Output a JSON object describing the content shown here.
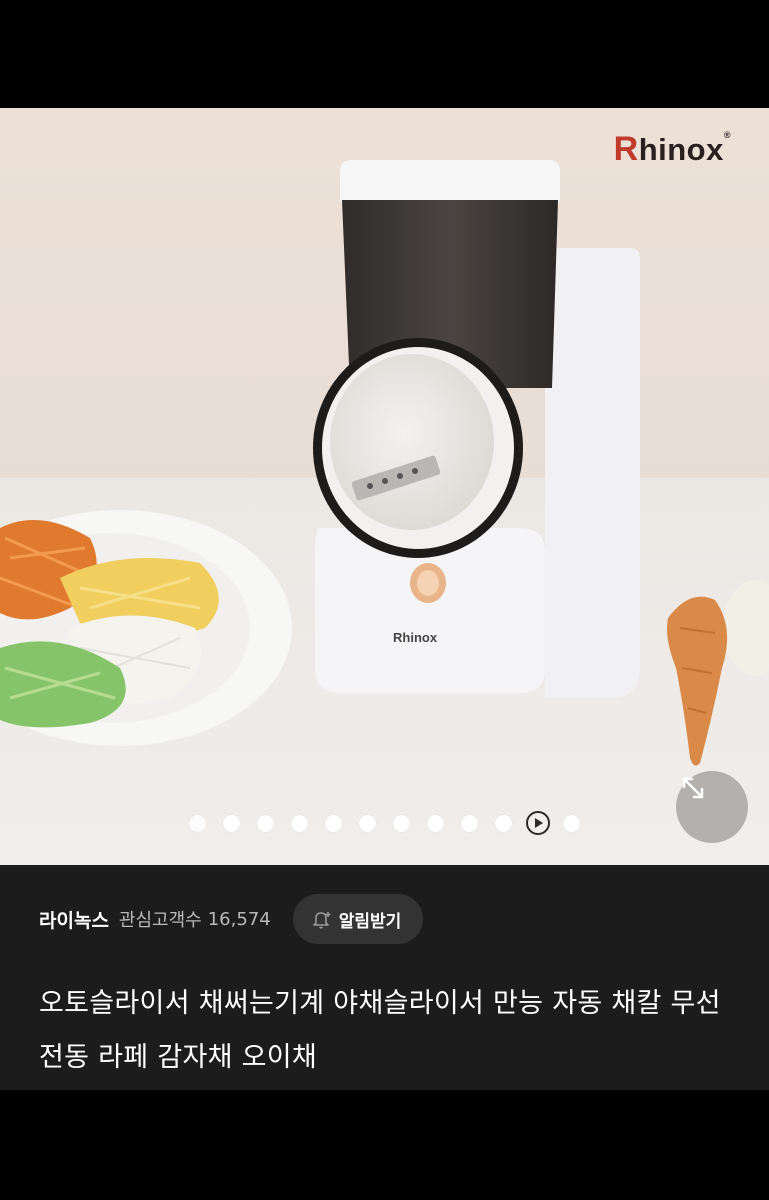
{
  "product_image": {
    "brand_logo": "Rhinox",
    "device_brand": "Rhinox",
    "gallery_count": 12,
    "active_index": 0,
    "icons": {
      "expand": "expand-arrows-icon",
      "play": "play-icon"
    }
  },
  "store": {
    "name": "라이녹스",
    "fans_label": "관심고객수",
    "fans_count": "16,574",
    "notify_label": "알림받기",
    "notify_icon": "bell-plus-icon"
  },
  "product": {
    "title": "오토슬라이서 채써는기계 야채슬라이서 만능 자동 채칼 무선 전동 라페 감자채 오이채"
  },
  "colors": {
    "background": "#000000",
    "info_panel": "#1c1c1c",
    "notify_button": "#333333",
    "logo_accent": "#c0392b"
  }
}
